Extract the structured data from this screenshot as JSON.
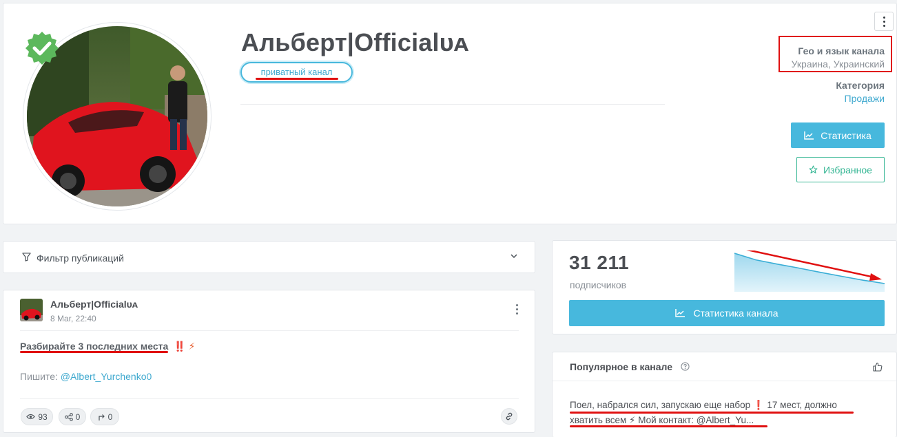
{
  "channel": {
    "title": "Альберт|Officialᴜᴀ",
    "privacy_badge": "приватный канал",
    "geo_label": "Гео и язык канала",
    "geo_value": "Украина, Украинский",
    "category_label": "Категория",
    "category_value": "Продажи",
    "stats_button": "Статистика",
    "favorite_button": "Избранное"
  },
  "filter": {
    "label": "Фильтр публикаций"
  },
  "post": {
    "author": "Альберт|Officialᴜᴀ",
    "date": "8 Mar, 22:40",
    "headline": "Разбирайте 3 последних места",
    "headline_emoji": "‼️ ⚡",
    "contact_prefix": "Пишите: ",
    "contact_handle": "@Albert_Yurchenko0",
    "views": "93",
    "shares": "0",
    "forwards": "0"
  },
  "subscribers": {
    "count": "31 211",
    "label": "подписчиков",
    "button": "Статистика канала",
    "trend": [
      100,
      80,
      67,
      55,
      42,
      30,
      18,
      8
    ]
  },
  "popular": {
    "title": "Популярное в канале",
    "text": "Поел, набрался сил, запускаю еще набор ❗ 17 мест, должно хватить всем ⚡ Мой контакт: @Albert_Yu..."
  },
  "colors": {
    "accent": "#47b8dd",
    "favorite": "#35b694",
    "annotation": "#e01010"
  }
}
